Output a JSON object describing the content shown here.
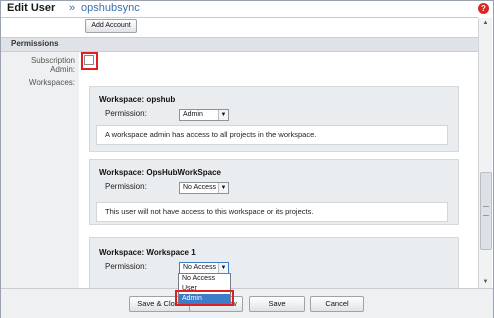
{
  "header": {
    "title": "Edit User",
    "separator": "»",
    "username": "opshubsync",
    "help_icon": "help-icon"
  },
  "toolbar": {
    "add_account_label": "Add Account"
  },
  "permissions": {
    "section_title": "Permissions",
    "subscription_admin_label_1": "Subscription",
    "subscription_admin_label_2": "Admin:",
    "subscription_admin_checked": false,
    "workspaces_label": "Workspaces:"
  },
  "workspaces": [
    {
      "title": "Workspace: opshub",
      "permission_label": "Permission:",
      "permission_value": "Admin",
      "description": "A workspace admin has access to all projects in the workspace."
    },
    {
      "title": "Workspace: OpsHubWorkSpace",
      "permission_label": "Permission:",
      "permission_value": "No Access",
      "description": "This user will not have access to this workspace or its projects."
    },
    {
      "title": "Workspace: Workspace 1",
      "permission_label": "Permission:",
      "permission_value": "No Access"
    }
  ],
  "dropdown": {
    "options": [
      "No Access",
      "User",
      "Admin"
    ],
    "highlighted": "Admin"
  },
  "footer": {
    "save_close_label": "Save & Close",
    "save_new_label": "Save & New",
    "save_label": "Save",
    "cancel_label": "Cancel"
  },
  "colors": {
    "accent": "#3a6fb0",
    "highlight_box": "#e02020",
    "selected_option": "#3d7cc9"
  }
}
